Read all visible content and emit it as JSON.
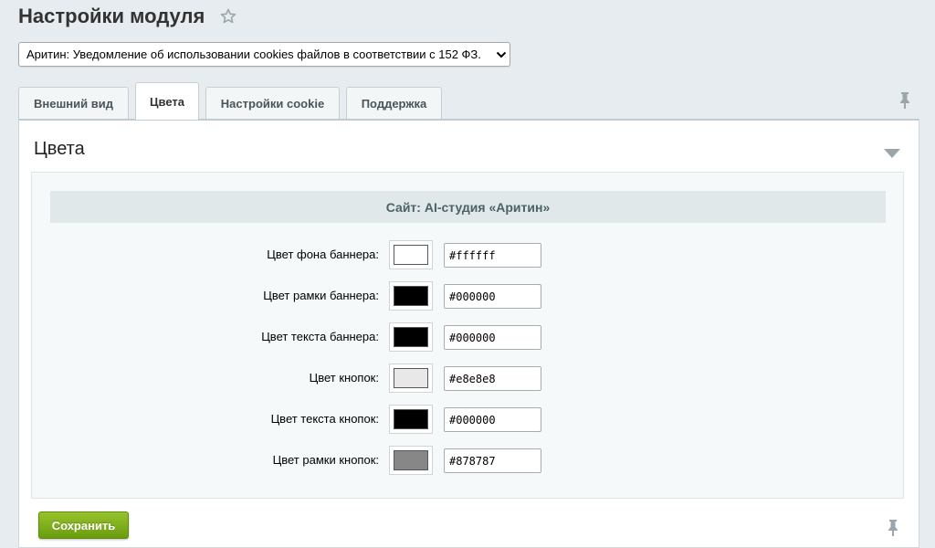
{
  "page": {
    "title": "Настройки модуля",
    "module_select_value": "Аритин: Уведомление об использовании cookies файлов в соответствии с 152 ФЗ."
  },
  "tabs": [
    {
      "label": "Внешний вид",
      "active": false
    },
    {
      "label": "Цвета",
      "active": true
    },
    {
      "label": "Настройки cookie",
      "active": false
    },
    {
      "label": "Поддержка",
      "active": false
    }
  ],
  "section": {
    "title": "Цвета",
    "site_header": "Сайт: AI-студия «Аритин»",
    "rows": [
      {
        "label": "Цвет фона баннера:",
        "value": "#ffffff",
        "color": "#ffffff"
      },
      {
        "label": "Цвет рамки баннера:",
        "value": "#000000",
        "color": "#000000"
      },
      {
        "label": "Цвет текста баннера:",
        "value": "#000000",
        "color": "#000000"
      },
      {
        "label": "Цвет кнопок:",
        "value": "#e8e8e8",
        "color": "#e8e8e8"
      },
      {
        "label": "Цвет текста кнопок:",
        "value": "#000000",
        "color": "#000000"
      },
      {
        "label": "Цвет рамки кнопок:",
        "value": "#878787",
        "color": "#878787"
      }
    ]
  },
  "footer": {
    "save_label": "Сохранить"
  },
  "colors": {
    "accent_green": "#7aab17",
    "panel_border": "#cfd8dc"
  },
  "icons": [
    "star-icon",
    "chevron-down-icon",
    "pin-icon",
    "collapse-triangle-icon"
  ]
}
